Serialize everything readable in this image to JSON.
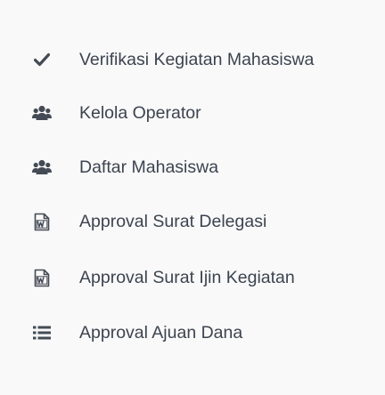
{
  "sidebar": {
    "items": [
      {
        "label": "Verifikasi Kegiatan Mahasiswa",
        "icon": "check-icon"
      },
      {
        "label": "Kelola Operator",
        "icon": "users-icon"
      },
      {
        "label": "Daftar Mahasiswa",
        "icon": "users-icon"
      },
      {
        "label": "Approval Surat Delegasi",
        "icon": "file-word-icon"
      },
      {
        "label": "Approval Surat Ijin Kegiatan",
        "icon": "file-word-icon"
      },
      {
        "label": "Approval Ajuan Dana",
        "icon": "list-icon"
      }
    ]
  },
  "colors": {
    "background": "#f9f9f9",
    "text": "#3c4450",
    "icon": "#444b55"
  }
}
